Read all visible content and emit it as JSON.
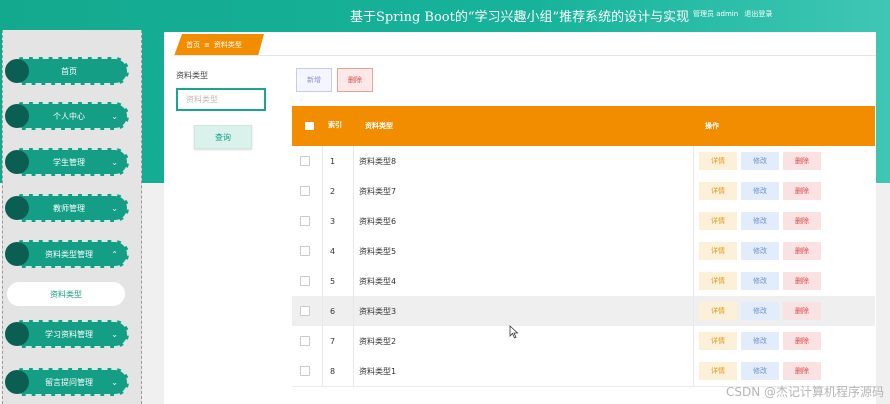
{
  "header": {
    "title": "基于Spring Boot的“学习兴趣小组”推荐系统的设计与实现",
    "user_label": "管理员 admin",
    "logout": "退出登录"
  },
  "sidebar": {
    "items": [
      {
        "label": "首页",
        "has_chevron": false
      },
      {
        "label": "个人中心",
        "has_chevron": true
      },
      {
        "label": "学生管理",
        "has_chevron": true
      },
      {
        "label": "教师管理",
        "has_chevron": true
      },
      {
        "label": "资料类型管理",
        "has_chevron": true,
        "expanded": true
      },
      {
        "label": "学习资料管理",
        "has_chevron": true
      },
      {
        "label": "留言提问管理",
        "has_chevron": true
      }
    ],
    "sub_item": "资料类型"
  },
  "breadcrumb": {
    "home": "首页",
    "separator": "≡",
    "current": "资料类型"
  },
  "search": {
    "label": "资料类型",
    "placeholder": "资料类型",
    "button": "查询"
  },
  "toolbar": {
    "add": "新增",
    "delete": "删除"
  },
  "table": {
    "headers": {
      "index": "索引",
      "type": "资料类型",
      "actions": "操作"
    },
    "rows": [
      {
        "index": "1",
        "type": "资料类型8"
      },
      {
        "index": "2",
        "type": "资料类型7"
      },
      {
        "index": "3",
        "type": "资料类型6"
      },
      {
        "index": "4",
        "type": "资料类型5"
      },
      {
        "index": "5",
        "type": "资料类型4"
      },
      {
        "index": "6",
        "type": "资料类型3"
      },
      {
        "index": "7",
        "type": "资料类型2"
      },
      {
        "index": "8",
        "type": "资料类型1"
      }
    ],
    "action_labels": {
      "detail": "详情",
      "edit": "修改",
      "delete": "删除"
    }
  },
  "watermark": "CSDN @杰记计算机程序源码",
  "colors": {
    "primary": "#149e86",
    "accent": "#f28d00"
  }
}
